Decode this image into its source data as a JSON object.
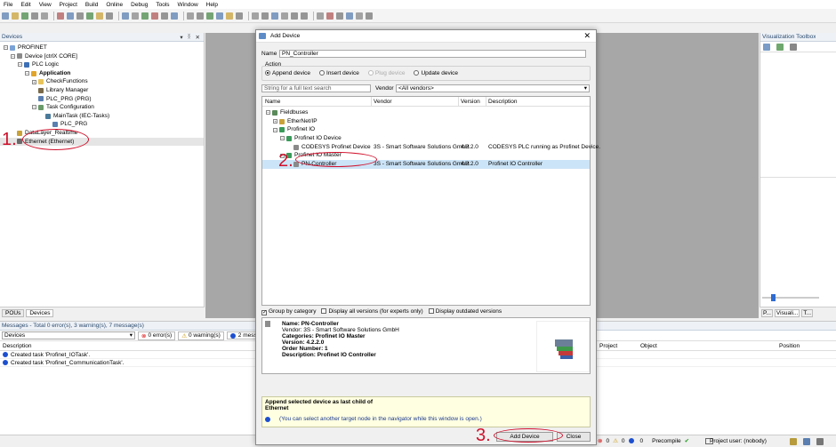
{
  "menu": [
    "File",
    "Edit",
    "View",
    "Project",
    "Build",
    "Online",
    "Debug",
    "Tools",
    "Window",
    "Help"
  ],
  "devices_panel": {
    "title": "Devices",
    "tree": [
      {
        "label": "PROFINET",
        "level": 0,
        "icon": "project-icon"
      },
      {
        "label": "Device [ctrlX CORE]",
        "level": 1,
        "icon": "device-icon"
      },
      {
        "label": "PLC Logic",
        "level": 2,
        "icon": "plc-logic-icon"
      },
      {
        "label": "Application",
        "level": 3,
        "icon": "application-icon",
        "bold": true
      },
      {
        "label": "CheckFunctions",
        "level": 4,
        "icon": "folder-icon"
      },
      {
        "label": "Library Manager",
        "level": 4,
        "icon": "library-icon"
      },
      {
        "label": "PLC_PRG (PRG)",
        "level": 4,
        "icon": "program-icon"
      },
      {
        "label": "Task Configuration",
        "level": 4,
        "icon": "task-config-icon"
      },
      {
        "label": "MainTask (IEC-Tasks)",
        "level": 5,
        "icon": "task-icon"
      },
      {
        "label": "PLC_PRG",
        "level": 6,
        "icon": "program-icon"
      },
      {
        "label": "DataLayer_Realtime",
        "level": 1,
        "icon": "datalayer-icon"
      },
      {
        "label": "Ethernet (Ethernet)",
        "level": 1,
        "icon": "ethernet-icon",
        "selected": true
      }
    ],
    "bottom_tabs": [
      "POUs",
      "Devices"
    ]
  },
  "annotations": {
    "step1": "1.",
    "step2": "2.",
    "step3": "3."
  },
  "dialog": {
    "title": "Add Device",
    "name_label": "Name",
    "name_value": "PN_Controller",
    "action_label": "Action",
    "actions": [
      {
        "label": "Append device",
        "selected": true,
        "enabled": true
      },
      {
        "label": "Insert device",
        "selected": false,
        "enabled": true
      },
      {
        "label": "Plug device",
        "selected": false,
        "enabled": false
      },
      {
        "label": "Update device",
        "selected": false,
        "enabled": true
      }
    ],
    "search_placeholder": "String for a full text search",
    "vendor_label": "Vendor",
    "vendor_value": "<All vendors>",
    "columns": [
      "Name",
      "Vendor",
      "Version",
      "Description"
    ],
    "rows": [
      {
        "name": "Fieldbuses",
        "level": 0,
        "vendor": "",
        "version": "",
        "description": "",
        "icon": "fieldbus-icon"
      },
      {
        "name": "EtherNet/IP",
        "level": 1,
        "vendor": "",
        "version": "",
        "description": "",
        "icon": "ethernetip-icon"
      },
      {
        "name": "Profinet IO",
        "level": 1,
        "vendor": "",
        "version": "",
        "description": "",
        "icon": "profinet-icon"
      },
      {
        "name": "Profinet IO Device",
        "level": 2,
        "vendor": "",
        "version": "",
        "description": "",
        "icon": "profinet-device-icon"
      },
      {
        "name": "CODESYS Profinet Device",
        "level": 3,
        "vendor": "3S - Smart Software Solutions GmbH",
        "version": "4.2.2.0",
        "description": "CODESYS PLC running as Profinet Device.",
        "icon": "device-icon"
      },
      {
        "name": "Profinet IO Master",
        "level": 2,
        "vendor": "",
        "version": "",
        "description": "",
        "icon": "profinet-master-icon"
      },
      {
        "name": "PN-Controller",
        "level": 3,
        "vendor": "3S - Smart Software Solutions GmbH",
        "version": "4.2.2.0",
        "description": "Profinet IO Controller",
        "icon": "controller-icon",
        "selected": true
      }
    ],
    "options": [
      {
        "label": "Group by category",
        "checked": true
      },
      {
        "label": "Display all versions (for experts only)",
        "checked": false
      },
      {
        "label": "Display outdated versions",
        "checked": false
      }
    ],
    "info": {
      "name": "Name: PN-Controller",
      "vendor": "Vendor: 3S - Smart Software Solutions GmbH",
      "categories": "Categories: Profinet IO Master",
      "version": "Version: 4.2.2.0",
      "order_number": "Order Number: 1",
      "description": "Description: Profinet IO Controller"
    },
    "hint_line1": "Append selected device as last child of",
    "hint_line2": "Ethernet",
    "hint_note": "(You can select another target node in the navigator while this window is open.)",
    "add_button": "Add Device",
    "close_button": "Close"
  },
  "toolbox": {
    "title": "Visualization Toolbox",
    "tabs": [
      "P...",
      "Visuali...",
      "T..."
    ]
  },
  "messages": {
    "title": "Messages - Total 0 error(s), 3 warning(s), 7 message(s)",
    "filter": "Devices",
    "errors": "0 error(s)",
    "warnings": "0 warning(s)",
    "messages": "2 message(s)",
    "columns": [
      "Description",
      "Project",
      "Object",
      "Position"
    ],
    "rows": [
      "Created task 'Profinet_IOTask'.",
      "Created task 'Profinet_CommunicationTask'."
    ]
  },
  "status": {
    "errors": "0",
    "warnings": "0",
    "messages": "0",
    "precompile": "Precompile",
    "user": "Project user: (nobody)"
  }
}
